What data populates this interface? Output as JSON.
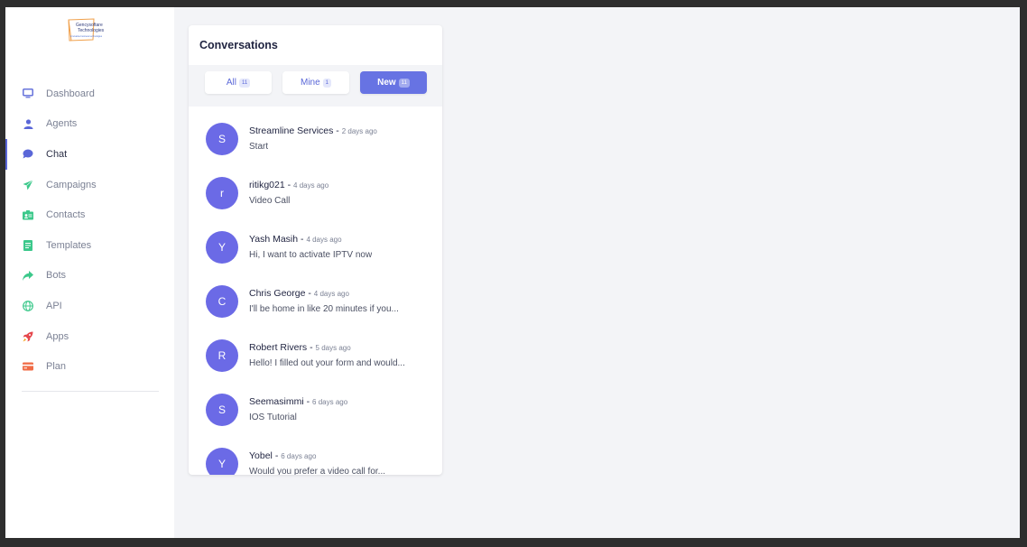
{
  "brand": {
    "logo_line1": "Gencysoftare",
    "logo_line2": "Technologies",
    "logo_tagline": "Innovative business technologies"
  },
  "sidebar": {
    "items": [
      {
        "label": "Dashboard",
        "icon": "monitor-icon",
        "color": "#5a67d8"
      },
      {
        "label": "Agents",
        "icon": "user-icon",
        "color": "#5a67d8"
      },
      {
        "label": "Chat",
        "icon": "chat-bubble-icon",
        "color": "#5a67d8",
        "active": true
      },
      {
        "label": "Campaigns",
        "icon": "paper-plane-icon",
        "color": "#3cc88b"
      },
      {
        "label": "Contacts",
        "icon": "contact-card-icon",
        "color": "#3cc88b"
      },
      {
        "label": "Templates",
        "icon": "document-icon",
        "color": "#3cc88b"
      },
      {
        "label": "Bots",
        "icon": "share-arrow-icon",
        "color": "#3cc88b"
      },
      {
        "label": "API",
        "icon": "globe-icon",
        "color": "#3cc88b"
      },
      {
        "label": "Apps",
        "icon": "rocket-icon",
        "color": "#e5484d"
      },
      {
        "label": "Plan",
        "icon": "credit-card-icon",
        "color": "#f06b45"
      }
    ]
  },
  "conversations": {
    "title": "Conversations",
    "filters": [
      {
        "label": "All",
        "count": "11"
      },
      {
        "label": "Mine",
        "count": "1"
      },
      {
        "label": "New",
        "count": "11",
        "active": true
      }
    ],
    "items": [
      {
        "initial": "S",
        "name": "Streamline Services",
        "time": "2 days ago",
        "message": "Start"
      },
      {
        "initial": "r",
        "name": "ritikg021",
        "time": "4 days ago",
        "message": "Video Call"
      },
      {
        "initial": "Y",
        "name": "Yash Masih",
        "time": "4 days ago",
        "message": "Hi, I want to activate IPTV now"
      },
      {
        "initial": "C",
        "name": "Chris George",
        "time": "4 days ago",
        "message": "I'll be home in like 20 minutes if you..."
      },
      {
        "initial": "R",
        "name": "Robert Rivers",
        "time": "5 days ago",
        "message": "Hello! I filled out your form and would..."
      },
      {
        "initial": "S",
        "name": "Seemasimmi",
        "time": "6 days ago",
        "message": "IOS Tutorial"
      },
      {
        "initial": "Y",
        "name": "Yobel",
        "time": "6 days ago",
        "message": "Would you prefer a video call for..."
      }
    ]
  },
  "colors": {
    "accent": "#5a67d8",
    "avatar": "#6b6ae6",
    "active_filter": "#6773e3"
  }
}
